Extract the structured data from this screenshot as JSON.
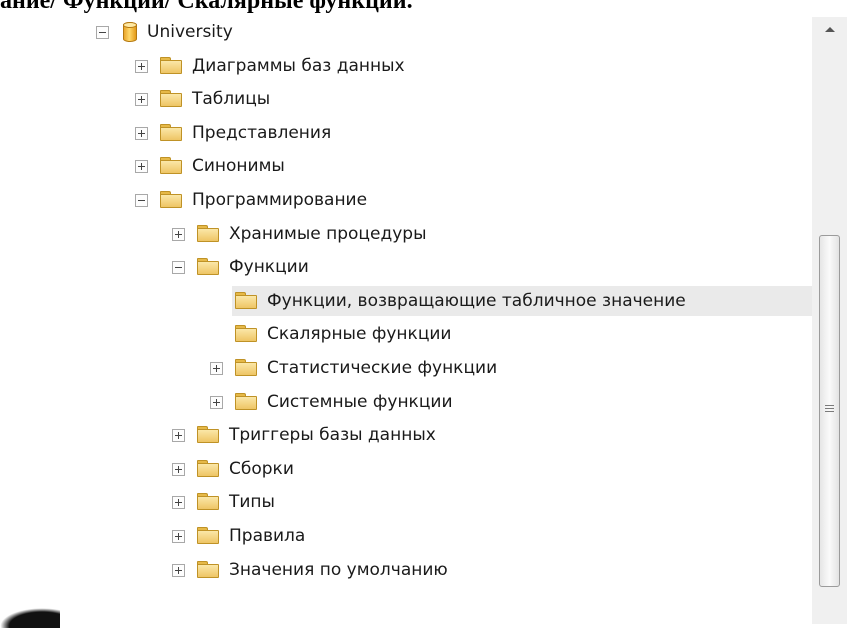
{
  "page": {
    "heading": "ание/ Функции/ Скалярные функции."
  },
  "tree": {
    "nodes": [
      {
        "id": "root",
        "label": "University",
        "icon": "database-icon",
        "toggle": "minus",
        "level": 0
      },
      {
        "id": "diagrams",
        "label": "Диаграммы баз данных",
        "icon": "folder-icon",
        "toggle": "plus",
        "level": 1
      },
      {
        "id": "tables",
        "label": "Таблицы",
        "icon": "folder-icon",
        "toggle": "plus",
        "level": 1
      },
      {
        "id": "views",
        "label": "Представления",
        "icon": "folder-icon",
        "toggle": "plus",
        "level": 1
      },
      {
        "id": "synonyms",
        "label": "Синонимы",
        "icon": "folder-icon",
        "toggle": "plus",
        "level": 1
      },
      {
        "id": "programmability",
        "label": "Программирование",
        "icon": "folder-icon",
        "toggle": "minus",
        "level": 1
      },
      {
        "id": "stored-procedures",
        "label": "Хранимые процедуры",
        "icon": "folder-icon",
        "toggle": "plus",
        "level": 2
      },
      {
        "id": "functions",
        "label": "Функции",
        "icon": "folder-icon",
        "toggle": "minus",
        "level": 2
      },
      {
        "id": "table-valued-functions",
        "label": "Функции, возвращающие табличное значение",
        "icon": "folder-icon",
        "toggle": "none",
        "level": 3,
        "selected": true
      },
      {
        "id": "scalar-functions",
        "label": "Скалярные функции",
        "icon": "folder-icon",
        "toggle": "none",
        "level": 3
      },
      {
        "id": "aggregate-functions",
        "label": "Статистические функции",
        "icon": "folder-icon",
        "toggle": "plus",
        "level": 3
      },
      {
        "id": "system-functions",
        "label": "Системные функции",
        "icon": "folder-icon",
        "toggle": "plus",
        "level": 3
      },
      {
        "id": "database-triggers",
        "label": "Триггеры базы данных",
        "icon": "folder-icon",
        "toggle": "plus",
        "level": 2
      },
      {
        "id": "assemblies",
        "label": "Сборки",
        "icon": "folder-icon",
        "toggle": "plus",
        "level": 2
      },
      {
        "id": "types",
        "label": "Типы",
        "icon": "folder-icon",
        "toggle": "plus",
        "level": 2
      },
      {
        "id": "rules",
        "label": "Правила",
        "icon": "folder-icon",
        "toggle": "plus",
        "level": 2
      },
      {
        "id": "defaults",
        "label": "Значения по умолчанию",
        "icon": "folder-icon",
        "toggle": "plus",
        "level": 2
      }
    ]
  },
  "scrollbar": {
    "up_icon": "arrow-up-icon",
    "grip_icon": "grip-icon"
  },
  "colors": {
    "selection": "#eaeaea",
    "folder": "#eec565",
    "database": "#e9a52a"
  }
}
